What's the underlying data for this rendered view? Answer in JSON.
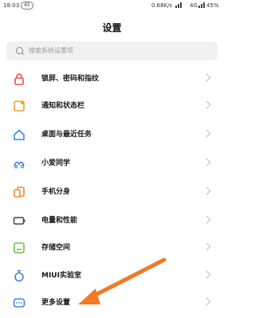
{
  "status_bar": {
    "time": "18:03",
    "badge": "45",
    "speed": "0.68K/s",
    "network": "4G",
    "battery": "45%"
  },
  "page_title": "设置",
  "search": {
    "placeholder": "搜索系统设置项"
  },
  "items": [
    {
      "label": "锁屏、密码和指纹",
      "icon": "lock-icon",
      "color": "#e8504d"
    },
    {
      "label": "通知和状态栏",
      "icon": "notification-icon",
      "color": "#f2a12b"
    },
    {
      "label": "桌面与最近任务",
      "icon": "home-icon",
      "color": "#3a86e8"
    },
    {
      "label": "小爱同学",
      "icon": "assistant-icon",
      "color": "#3a86e8"
    },
    {
      "label": "手机分身",
      "icon": "phone-clone-icon",
      "color": "#f08a24"
    },
    {
      "label": "电量和性能",
      "icon": "battery-icon",
      "color": "#444444"
    },
    {
      "label": "存储空间",
      "icon": "storage-icon",
      "color": "#6cc04a"
    },
    {
      "label": "MIUI实验室",
      "icon": "lab-flask-icon",
      "color": "#3a86e8"
    },
    {
      "label": "更多设置",
      "icon": "more-settings-icon",
      "color": "#3a86e8"
    }
  ],
  "annotation": {
    "color": "#f07a25"
  }
}
